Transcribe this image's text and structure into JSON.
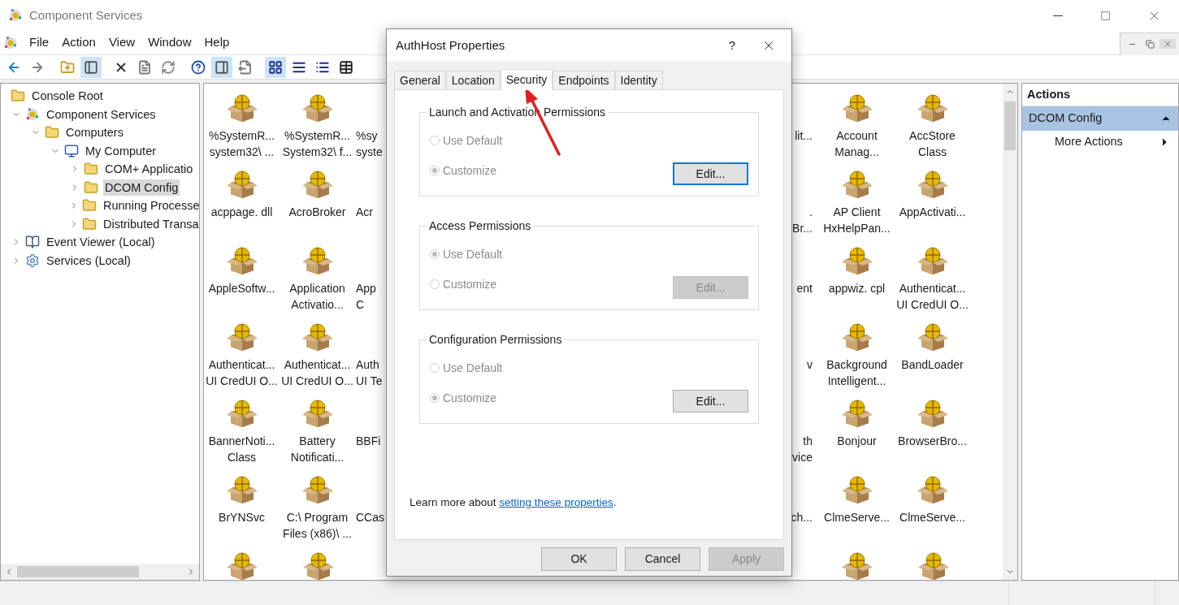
{
  "window": {
    "title": "Component Services"
  },
  "menu": [
    "File",
    "Action",
    "View",
    "Window",
    "Help"
  ],
  "toolbar": [
    {
      "kind": "back",
      "pressed": false
    },
    {
      "kind": "forward",
      "pressed": false
    },
    {
      "kind": "up",
      "pressed": false
    },
    {
      "kind": "tree",
      "pressed": true
    },
    {
      "kind": "delete",
      "pressed": false
    },
    {
      "kind": "properties",
      "pressed": false
    },
    {
      "kind": "refresh",
      "pressed": false
    },
    {
      "kind": "help",
      "pressed": false
    },
    {
      "kind": "actionpane",
      "pressed": true
    },
    {
      "kind": "export",
      "pressed": false
    },
    {
      "kind": "large",
      "pressed": true
    },
    {
      "kind": "small",
      "pressed": false
    },
    {
      "kind": "list",
      "pressed": false
    },
    {
      "kind": "details",
      "pressed": false
    }
  ],
  "tree": [
    {
      "label": "Console Root",
      "kind": "folder",
      "selected": false,
      "children": [
        {
          "label": "Component Services",
          "kind": "component",
          "expanded": true,
          "selected": false,
          "children": [
            {
              "label": "Computers",
              "kind": "folder",
              "expanded": true,
              "selected": false,
              "children": [
                {
                  "label": "My Computer",
                  "kind": "computer",
                  "expanded": true,
                  "selected": false,
                  "children": [
                    {
                      "label": "COM+ Applicatio",
                      "kind": "folder",
                      "expanded": false,
                      "selected": false
                    },
                    {
                      "label": "DCOM Config",
                      "kind": "folder",
                      "expanded": false,
                      "selected": true
                    },
                    {
                      "label": "Running Processe",
                      "kind": "folder",
                      "expanded": false,
                      "selected": false
                    },
                    {
                      "label": "Distributed Transa",
                      "kind": "folder",
                      "expanded": false,
                      "selected": false
                    }
                  ]
                }
              ]
            }
          ]
        },
        {
          "label": "Event Viewer (Local)",
          "kind": "log",
          "expanded": false,
          "selected": false
        },
        {
          "label": "Services (Local)",
          "kind": "gear",
          "expanded": false,
          "selected": false
        }
      ]
    }
  ],
  "grid_rows": [
    {
      "left": [
        [
          "%SystemR...",
          "system32\\ ..."
        ],
        [
          "%SystemR...",
          "System32\\ f..."
        ]
      ],
      "left_partial": [
        "%sy",
        "syste"
      ],
      "right_partial": [
        "lit..."
      ],
      "right": [
        [
          "Account",
          "Manag..."
        ],
        [
          "AccStore",
          "Class"
        ]
      ]
    },
    {
      "left": [
        [
          "acppage. dll"
        ],
        [
          "AcroBroker"
        ]
      ],
      "left_partial": [
        "Acr"
      ],
      "right_partial": [
        ".",
        "Br..."
      ],
      "right": [
        [
          "AP Client",
          "HxHelpPan..."
        ],
        [
          "AppActivati..."
        ]
      ]
    },
    {
      "left": [
        [
          "AppleSoftw..."
        ],
        [
          "Application",
          "Activatio..."
        ]
      ],
      "left_partial": [
        "App",
        "C"
      ],
      "right_partial": [
        "ent"
      ],
      "right": [
        [
          "appwiz. cpl"
        ],
        [
          "Authenticat...",
          "UI CredUI O..."
        ]
      ]
    },
    {
      "left": [
        [
          "Authenticat...",
          "UI CredUI O..."
        ],
        [
          "Authenticat...",
          "UI CredUI O..."
        ]
      ],
      "left_partial": [
        "Auth",
        "UI Te"
      ],
      "right_partial": [
        "v"
      ],
      "right": [
        [
          "Background",
          "Intelligent..."
        ],
        [
          "BandLoader"
        ]
      ]
    },
    {
      "left": [
        [
          "BannerNoti...",
          "Class"
        ],
        [
          "Battery",
          "Notificati..."
        ]
      ],
      "left_partial": [
        "BBFi"
      ],
      "right_partial": [
        "th",
        "vice"
      ],
      "right": [
        [
          "Bonjour"
        ],
        [
          "BrowserBro..."
        ]
      ]
    },
    {
      "left": [
        [
          "BrYNSvc"
        ],
        [
          "C:\\ Program",
          "Files (x86)\\ ..."
        ]
      ],
      "left_partial": [
        "CCas"
      ],
      "right_partial": [
        "ch..."
      ],
      "right": [
        [
          "ClmeServe..."
        ],
        [
          "ClmeServe..."
        ]
      ]
    }
  ],
  "actions": {
    "title": "Actions",
    "section": {
      "label": "DCOM Config",
      "expanded": true
    },
    "items": [
      {
        "label": "More Actions"
      }
    ]
  },
  "dialog": {
    "title": "AuthHost Properties",
    "help": "?",
    "tabs": [
      {
        "label": "General",
        "selected": false
      },
      {
        "label": "Location",
        "selected": false
      },
      {
        "label": "Security",
        "selected": true
      },
      {
        "label": "Endpoints",
        "selected": false
      },
      {
        "label": "Identity",
        "selected": false
      }
    ],
    "groups": [
      {
        "title": "Launch and Activation Permissions",
        "options": [
          {
            "label": "Use Default",
            "selected": false,
            "disabled": true
          },
          {
            "label": "Customize",
            "selected": true,
            "disabled": true
          }
        ],
        "edit": {
          "label": "Edit...",
          "disabled": false,
          "focused": true
        }
      },
      {
        "title": "Access Permissions",
        "options": [
          {
            "label": "Use Default",
            "selected": true,
            "disabled": true
          },
          {
            "label": "Customize",
            "selected": false,
            "disabled": true
          }
        ],
        "edit": {
          "label": "Edit...",
          "disabled": true,
          "focused": false
        }
      },
      {
        "title": "Configuration Permissions",
        "options": [
          {
            "label": "Use Default",
            "selected": false,
            "disabled": true
          },
          {
            "label": "Customize",
            "selected": true,
            "disabled": true
          }
        ],
        "edit": {
          "label": "Edit...",
          "disabled": false,
          "focused": false
        }
      }
    ],
    "note": {
      "before": "Learn more about ",
      "link": "setting these properties",
      "after": "."
    },
    "buttons": [
      {
        "label": "OK",
        "disabled": false
      },
      {
        "label": "Cancel",
        "disabled": false
      },
      {
        "label": "Apply",
        "disabled": true
      }
    ]
  }
}
